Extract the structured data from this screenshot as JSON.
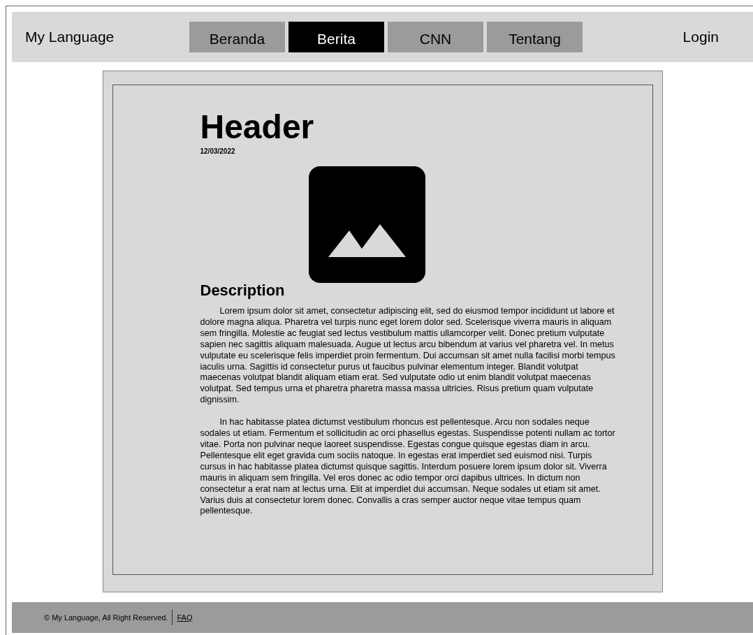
{
  "brand": "My Language",
  "nav": [
    {
      "label": "Beranda",
      "selected": false
    },
    {
      "label": "Berita",
      "selected": true
    },
    {
      "label": "CNN",
      "selected": false
    },
    {
      "label": "Tentang",
      "selected": false
    }
  ],
  "login": "Login",
  "article": {
    "title": "Header",
    "date": "12/03/2022",
    "subtitle": "Description",
    "paragraphs": [
      "Lorem ipsum dolor sit amet, consectetur adipiscing elit, sed do eiusmod tempor incididunt ut labore et dolore magna aliqua. Pharetra vel turpis nunc eget lorem dolor sed. Scelerisque viverra mauris in aliquam sem fringilla. Molestie ac feugiat sed lectus vestibulum mattis ullamcorper velit. Donec pretium vulputate sapien nec sagittis aliquam malesuada. Augue ut lectus arcu bibendum at varius vel pharetra vel. In metus vulputate eu scelerisque felis imperdiet proin fermentum. Dui accumsan sit amet nulla facilisi morbi tempus iaculis urna. Sagittis id consectetur purus ut faucibus pulvinar elementum integer. Blandit volutpat maecenas volutpat blandit aliquam etiam erat. Sed vulputate odio ut enim blandit volutpat maecenas volutpat. Sed tempus urna et pharetra pharetra massa massa ultricies. Risus pretium quam vulputate dignissim.",
      "In hac habitasse platea dictumst vestibulum rhoncus est pellentesque. Arcu non sodales neque sodales ut etiam. Fermentum et sollicitudin ac orci phasellus egestas. Suspendisse potenti nullam ac tortor vitae. Porta non pulvinar neque laoreet suspendisse. Egestas congue quisque egestas diam in arcu. Pellentesque elit eget gravida cum sociis natoque. In egestas erat imperdiet sed euismod nisi. Turpis cursus in hac habitasse platea dictumst quisque sagittis. Interdum posuere lorem ipsum dolor sit. Viverra mauris in aliquam sem fringilla. Vel eros donec ac odio tempor orci dapibus ultrices. In dictum non consectetur a erat nam at lectus urna. Elit at imperdiet dui accumsan. Neque sodales ut etiam sit amet. Varius duis at consectetur lorem donec. Convallis a cras semper auctor neque vitae tempus quam pellentesque."
    ]
  },
  "footer": {
    "copyright": "© My Language, All Right Reserved.",
    "link": "FAQ"
  }
}
